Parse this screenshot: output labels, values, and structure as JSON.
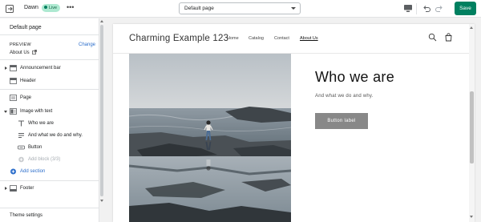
{
  "topbar": {
    "theme_name": "Dawn",
    "status_badge": "Live",
    "more_label": "•••",
    "page_select_value": "Default page",
    "save_label": "Save"
  },
  "sidebar": {
    "title": "Default page",
    "preview_label": "PREVIEW",
    "change_label": "Change",
    "preview_page": "About Us",
    "sections": [
      {
        "label": "Announcement bar"
      },
      {
        "label": "Header"
      },
      {
        "label": "Page"
      },
      {
        "label": "Image with text"
      }
    ],
    "blocks": [
      {
        "label": "Who we are",
        "icon": "text-icon"
      },
      {
        "label": "And what we do and why.",
        "icon": "paragraph-icon"
      },
      {
        "label": "Button",
        "icon": "button-icon"
      },
      {
        "label": "Add block (3/3)",
        "icon": "add-circle-icon"
      }
    ],
    "add_section_label": "Add section",
    "footer_label": "Footer",
    "theme_settings_label": "Theme settings"
  },
  "preview": {
    "store_name": "Charming Example 123",
    "nav": [
      "Home",
      "Catalog",
      "Contact",
      "About Us"
    ],
    "active_nav": "About Us",
    "heading": "Who we are",
    "subheading": "And what we do and why.",
    "button_label": "Button label"
  },
  "colors": {
    "primary": "#008060",
    "link": "#2c6ecb",
    "live_badge": "#aee9d1"
  }
}
